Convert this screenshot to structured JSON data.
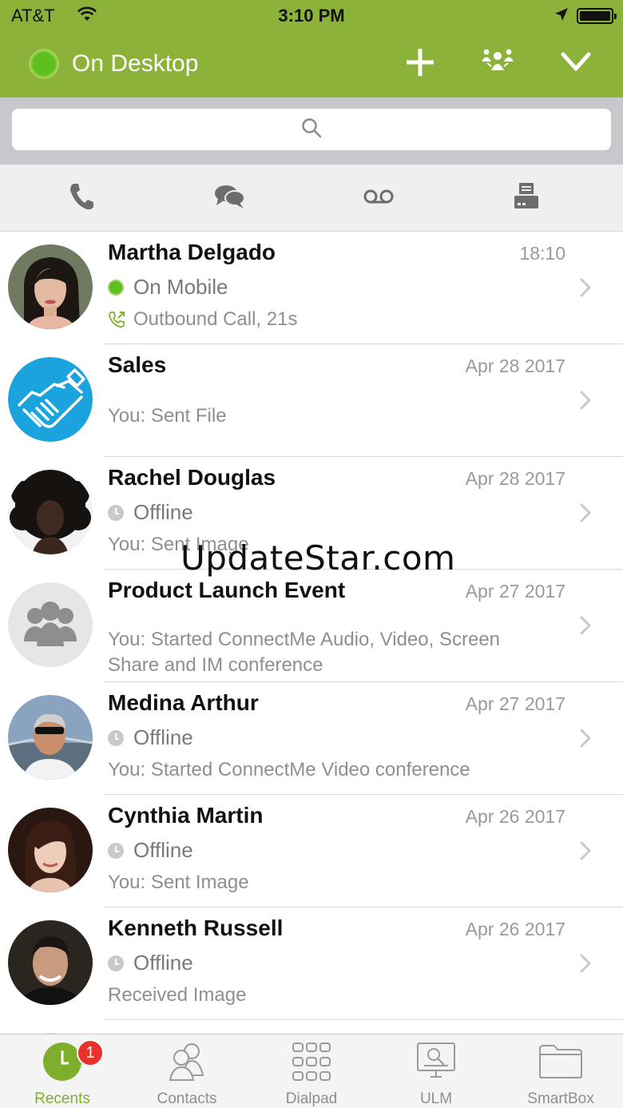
{
  "colors": {
    "brand": "#8cb23a",
    "online": "#5fbf1f",
    "badge": "#e8302c",
    "active_tab": "#7fae2c"
  },
  "status_bar": {
    "carrier": "AT&T",
    "time": "3:10 PM"
  },
  "header": {
    "presence_status": "On Desktop",
    "icons": [
      "plus-icon",
      "presence-group-icon",
      "chevron-down-icon"
    ]
  },
  "search": {
    "placeholder": "",
    "value": ""
  },
  "filters": [
    {
      "icon": "phone-icon"
    },
    {
      "icon": "chat-icon"
    },
    {
      "icon": "voicemail-icon"
    },
    {
      "icon": "fax-icon"
    }
  ],
  "recents": [
    {
      "name": "Martha Delgado",
      "date": "18:10",
      "status": "On Mobile",
      "detail": "Outbound Call, 21s"
    },
    {
      "name": "Sales",
      "date": "Apr 28 2017",
      "status": "",
      "detail": "You: Sent File"
    },
    {
      "name": "Rachel Douglas",
      "date": "Apr 28 2017",
      "status": "Offline",
      "detail": "You: Sent Image"
    },
    {
      "name": "Product Launch Event",
      "date": "Apr 27 2017",
      "status": "",
      "detail": "You: Started ConnectMe Audio, Video, Screen Share and IM conference"
    },
    {
      "name": "Medina Arthur",
      "date": "Apr 27 2017",
      "status": "Offline",
      "detail": "You: Started ConnectMe Video conference"
    },
    {
      "name": "Cynthia Martin",
      "date": "Apr 26 2017",
      "status": "Offline",
      "detail": "You: Sent Image"
    },
    {
      "name": "Kenneth Russell",
      "date": "Apr 26 2017",
      "status": "Offline",
      "detail": "Received Image"
    }
  ],
  "watermark": "UpdateStar.com",
  "tabbar": {
    "tabs": [
      {
        "label": "Recents",
        "icon": "clock-icon",
        "badge": "1"
      },
      {
        "label": "Contacts",
        "icon": "contacts-icon"
      },
      {
        "label": "Dialpad",
        "icon": "dialpad-icon"
      },
      {
        "label": "ULM",
        "icon": "ulm-icon"
      },
      {
        "label": "SmartBox",
        "icon": "folder-icon"
      }
    ]
  }
}
